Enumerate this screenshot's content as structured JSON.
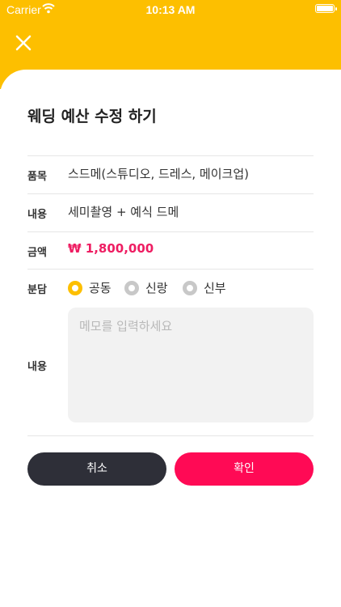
{
  "status_bar": {
    "carrier": "Carrier",
    "time": "10:13 AM"
  },
  "colors": {
    "header": "#fdbf00",
    "accent_pink": "#ff0a55",
    "price": "#ee1d62",
    "cancel_bg": "#2e2f38"
  },
  "title": "웨딩 예산 수정 하기",
  "form": {
    "item_label": "품목",
    "item_value": "스드메(스튜디오, 드레스, 메이크업)",
    "content_label": "내용",
    "content_value": "세미촬영 + 예식 드메",
    "amount_label": "금액",
    "amount_value": "₩ 1,800,000",
    "share_label": "분담",
    "share_options": [
      {
        "label": "공동",
        "selected": true
      },
      {
        "label": "신랑",
        "selected": false
      },
      {
        "label": "신부",
        "selected": false
      }
    ],
    "memo_label": "내용",
    "memo_placeholder": "메모를 입력하세요",
    "memo_value": ""
  },
  "buttons": {
    "cancel": "취소",
    "confirm": "확인"
  },
  "icons": {
    "close": "close-icon",
    "wifi": "wifi-icon",
    "battery": "battery-icon"
  }
}
